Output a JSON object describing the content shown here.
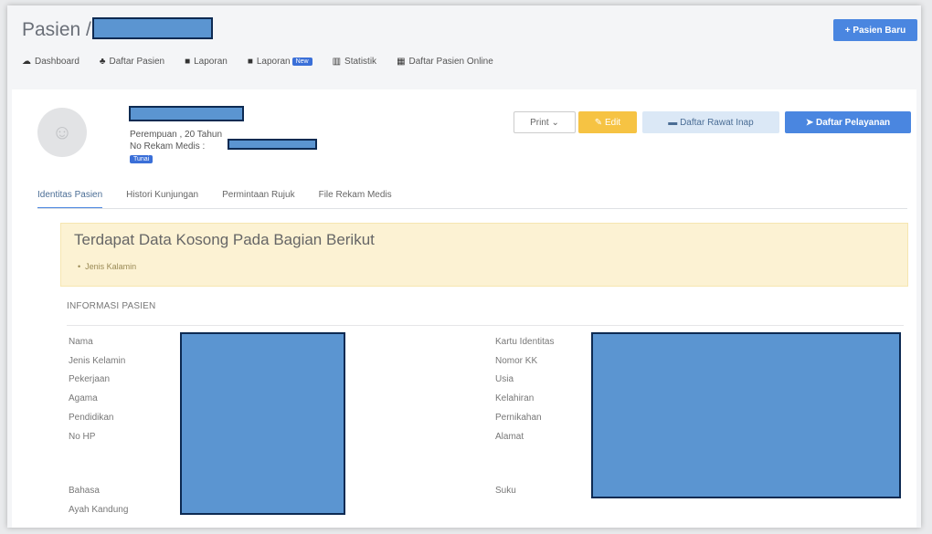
{
  "header": {
    "title": "Pasien /",
    "new_button_label": "+ Pasien Baru"
  },
  "nav": {
    "items": [
      {
        "icon": "dashboard-icon",
        "glyph": "☁",
        "label": "Dashboard"
      },
      {
        "icon": "users-icon",
        "glyph": "♣",
        "label": "Daftar Pasien"
      },
      {
        "icon": "report-icon",
        "glyph": "■",
        "label": "Laporan"
      },
      {
        "icon": "report-icon",
        "glyph": "■",
        "label": "Laporan",
        "badge": "New"
      },
      {
        "icon": "chart-icon",
        "glyph": "▥",
        "label": "Statistik"
      },
      {
        "icon": "list-icon",
        "glyph": "▦",
        "label": "Daftar Pasien Online"
      }
    ]
  },
  "patient": {
    "gender_age": "Perempuan , 20 Tahun",
    "rm_label": "No Rekam Medis :",
    "payment_badge": "Tunai"
  },
  "actions": {
    "print": "Print ⌄",
    "edit": "Edit",
    "rawat_inap": "Daftar Rawat Inap",
    "pelayanan": "Daftar Pelayanan"
  },
  "tabs": [
    "Identitas Pasien",
    "Histori Kunjungan",
    "Permintaan Rujuk",
    "File Rekam Medis"
  ],
  "alert": {
    "title": "Terdapat Data Kosong Pada Bagian Berikut",
    "items": [
      "Jenis Kalamin"
    ]
  },
  "info": {
    "section_title": "INFORMASI PASIEN",
    "left_labels": [
      "Nama",
      "Jenis Kelamin",
      "Pekerjaan",
      "Agama",
      "Pendidikan",
      "No HP",
      "Bahasa",
      "Ayah Kandung"
    ],
    "right_labels": [
      "Kartu Identitas",
      "Nomor KK",
      "Usia",
      "Kelahiran",
      "Pernikahan",
      "Alamat",
      "Suku"
    ]
  },
  "colors": {
    "primary": "#4a86e0",
    "warning": "#f6c343",
    "alert_bg": "#fcf2d3",
    "redaction": "#5b95d1"
  }
}
